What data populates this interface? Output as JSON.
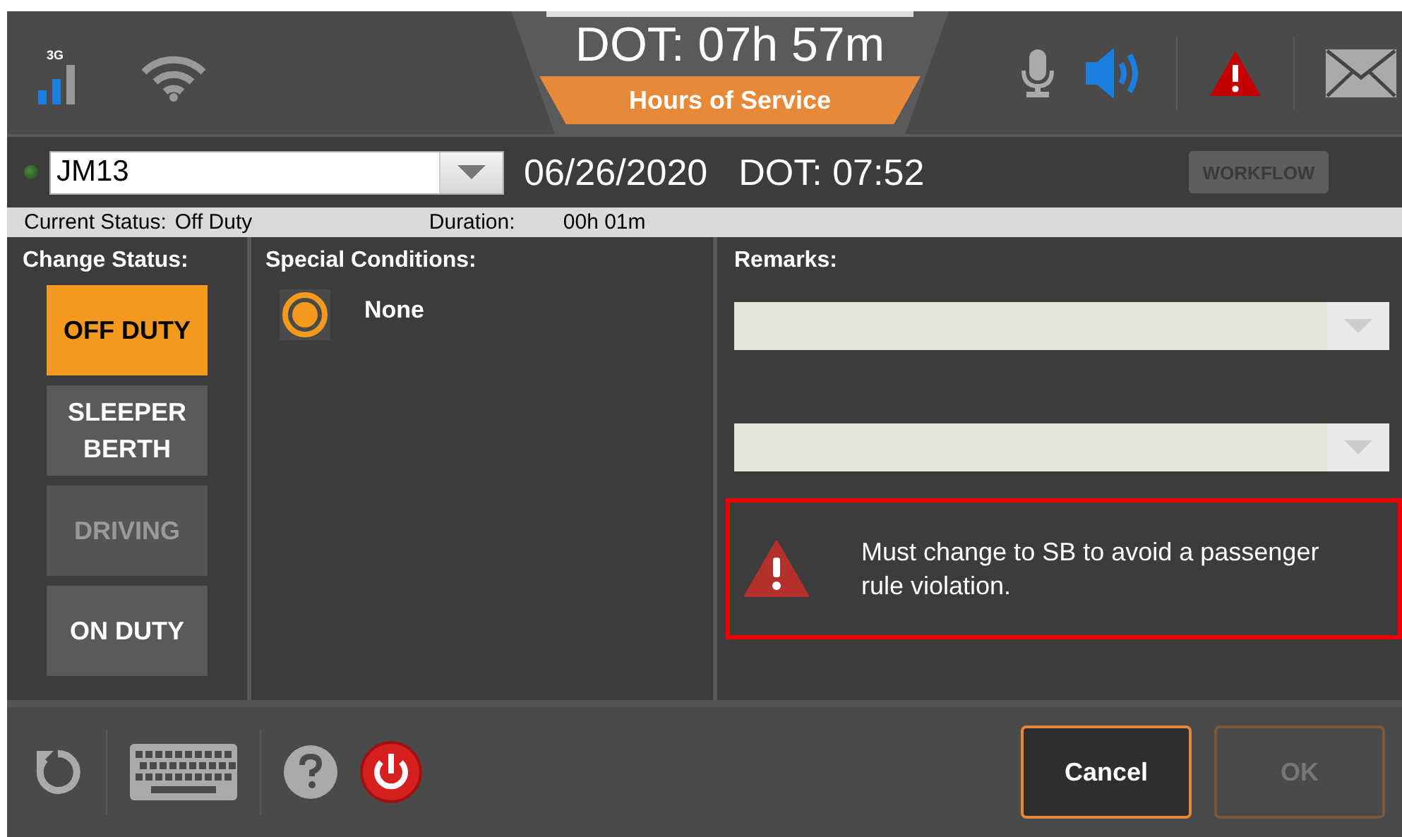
{
  "header": {
    "network": "3G",
    "title": "DOT: 07h 57m",
    "subtitle": "Hours of Service"
  },
  "driver_bar": {
    "driver": "JM13",
    "date": "06/26/2020",
    "dot": "DOT: 07:52",
    "workflow": {
      "label": "WORKFLOW",
      "disabled": true
    }
  },
  "status_bar": {
    "current_label": "Current Status:",
    "current": "Off Duty",
    "duration_label": "Duration:",
    "duration": "00h 01m"
  },
  "change_status": {
    "heading": "Change Status:",
    "buttons": [
      {
        "label": "OFF DUTY",
        "selected": true,
        "disabled": false
      },
      {
        "label": "SLEEPER BERTH",
        "selected": false,
        "disabled": false
      },
      {
        "label": "DRIVING",
        "selected": false,
        "disabled": true
      },
      {
        "label": "ON DUTY",
        "selected": false,
        "disabled": false
      }
    ]
  },
  "special_conditions": {
    "heading": "Special Conditions:",
    "options": [
      {
        "label": "None",
        "selected": true
      }
    ]
  },
  "remarks": {
    "heading": "Remarks:",
    "alert": "Must change to SB to avoid a passenger rule violation."
  },
  "footer": {
    "buttons": [
      {
        "label": "Cancel",
        "disabled": false
      },
      {
        "label": "OK",
        "disabled": true
      }
    ]
  }
}
